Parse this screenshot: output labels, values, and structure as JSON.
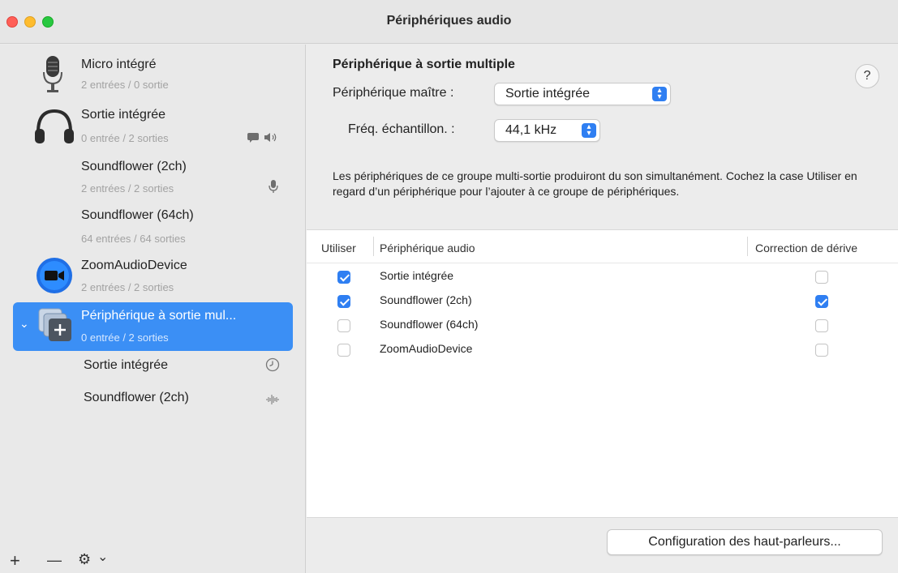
{
  "window": {
    "title": "Périphériques audio"
  },
  "sidebar": {
    "devices": [
      {
        "name": "Micro intégré",
        "sub": "2 entrées / 0 sortie",
        "icon": "microphone-icon"
      },
      {
        "name": "Sortie intégrée",
        "sub": "0 entrée / 2 sorties",
        "icon": "headphones-icon",
        "badges": [
          "alert-badge-icon",
          "speaker-icon"
        ]
      },
      {
        "name": "Soundflower (2ch)",
        "sub": "2 entrées / 2 sorties",
        "icon": "",
        "badges": [
          "microphone-small-icon"
        ]
      },
      {
        "name": "Soundflower (64ch)",
        "sub": "64 entrées / 64 sorties",
        "icon": ""
      },
      {
        "name": "ZoomAudioDevice",
        "sub": "2 entrées / 2 sorties",
        "icon": "zoom-camera-icon"
      },
      {
        "name": "Périphérique à sortie mul...",
        "sub": "0 entrée / 2 sorties",
        "icon": "aggregate-device-icon",
        "selected": true
      }
    ],
    "subdevices": [
      {
        "name": "Sortie intégrée",
        "icon": "clock-icon"
      },
      {
        "name": "Soundflower (2ch)",
        "icon": "waveform-icon"
      }
    ],
    "footer": {
      "add": "+",
      "remove": "—",
      "gear": "⚙",
      "chevron": "⌄"
    }
  },
  "main": {
    "heading": "Périphérique à sortie multiple",
    "help": "?",
    "master_label": "Périphérique maître :",
    "master_value": "Sortie intégrée",
    "rate_label": "Fréq. échantillon. :",
    "rate_value": "44,1 kHz",
    "description": "Les périphériques de ce groupe multi-sortie produiront du son simultanément. Cochez la case Utiliser en regard d’un périphérique pour l’ajouter à ce groupe de périphériques.",
    "table": {
      "headers": [
        "Utiliser",
        "Périphérique audio",
        "Correction de dérive"
      ],
      "rows": [
        {
          "use": true,
          "device": "Sortie intégrée",
          "drift": false
        },
        {
          "use": true,
          "device": "Soundflower (2ch)",
          "drift": true
        },
        {
          "use": false,
          "device": "Soundflower (64ch)",
          "drift": false
        },
        {
          "use": false,
          "device": "ZoomAudioDevice",
          "drift": false
        }
      ]
    },
    "config_button": "Configuration des haut-parleurs..."
  },
  "colors": {
    "accent": "#2f7ff2",
    "selection": "#3b8ff5"
  }
}
